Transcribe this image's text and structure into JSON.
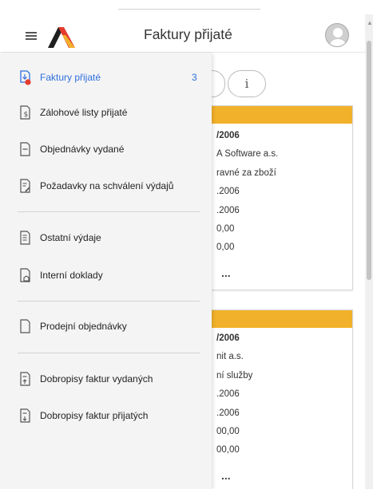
{
  "header": {
    "title": "Faktury přijaté",
    "brand_colors": {
      "red": "#e53b2e",
      "yellow": "#f2b12a",
      "dark": "#1f1f1f"
    }
  },
  "background": {
    "info_button_label": "i",
    "cards": [
      {
        "rows": [
          "/2006",
          "A Software a.s.",
          "ravné za zboží",
          ".2006",
          ".2006",
          "0,00",
          "0,00"
        ],
        "more": "..."
      },
      {
        "rows": [
          "/2006",
          "nit a.s.",
          "ní služby",
          ".2006",
          ".2006",
          "00,00",
          "00,00"
        ],
        "more": "..."
      }
    ]
  },
  "drawer": {
    "items": [
      {
        "label": "Faktury přijaté",
        "count": "3",
        "active": true,
        "icon": "invoice-in-icon"
      },
      {
        "label": "Zálohové listy přijaté",
        "icon": "deposit-icon"
      },
      {
        "label": "Objednávky vydané",
        "icon": "order-icon"
      },
      {
        "label": "Požadavky na schválení výdajů",
        "icon": "approval-icon"
      },
      {
        "label": "Ostatní výdaje",
        "icon": "expense-icon"
      },
      {
        "label": "Interní doklady",
        "icon": "internal-doc-icon"
      },
      {
        "label": "Prodejní objednávky",
        "icon": "sales-order-icon"
      },
      {
        "label": "Dobropisy faktur vydaných",
        "icon": "credit-note-out-icon"
      },
      {
        "label": "Dobropisy faktur přijatých",
        "icon": "credit-note-in-icon"
      }
    ],
    "active_color": "#2f6fde",
    "badge_color": "#e53b2e"
  }
}
